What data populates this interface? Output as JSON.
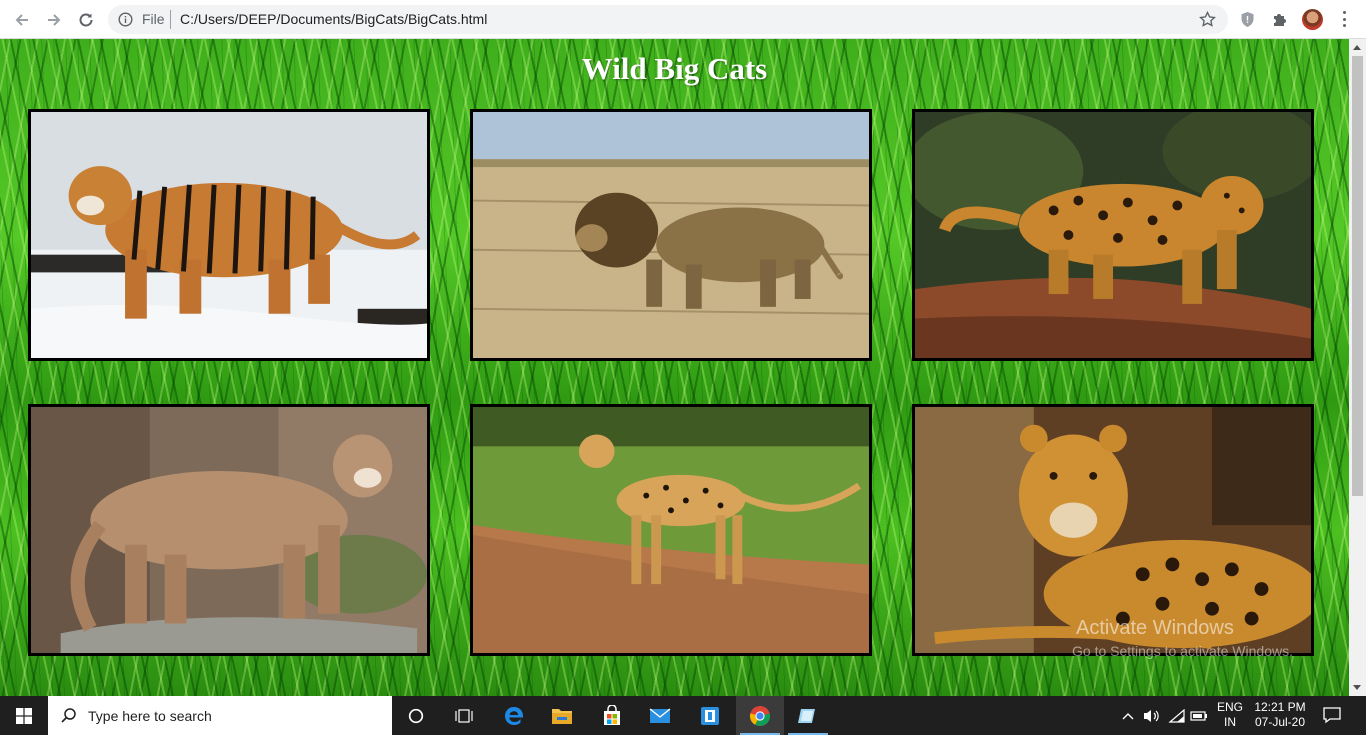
{
  "browser": {
    "url_scheme": "File",
    "url": "C:/Users/DEEP/Documents/BigCats/BigCats.html"
  },
  "page": {
    "title": "Wild Big Cats",
    "images": [
      {
        "animal": "tiger"
      },
      {
        "animal": "lion"
      },
      {
        "animal": "leopard"
      },
      {
        "animal": "cougar"
      },
      {
        "animal": "cheetah"
      },
      {
        "animal": "jaguar"
      }
    ],
    "watermark": {
      "line1": "Activate Windows",
      "line2": "Go to Settings to activate Windows."
    }
  },
  "taskbar": {
    "search_placeholder": "Type here to search",
    "language": "ENG",
    "region": "IN",
    "time": "12:21 PM",
    "date": "07-Jul-20"
  }
}
